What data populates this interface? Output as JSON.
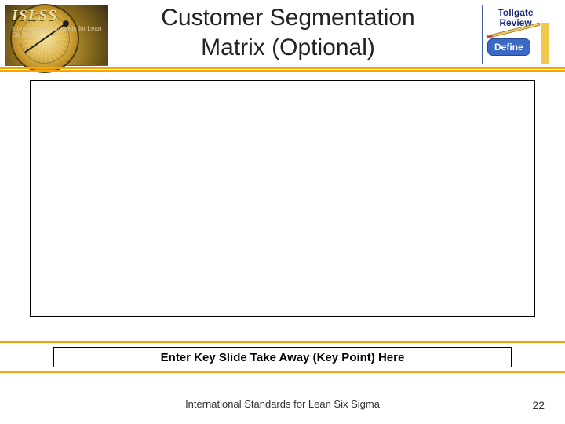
{
  "header": {
    "title_line1": "Customer Segmentation",
    "title_line2": "Matrix (Optional)"
  },
  "logo_left": {
    "brand": "ISLSS",
    "sub": "International Standards for Lean Six Sigma"
  },
  "badge_right": {
    "title_line1": "Tollgate",
    "title_line2": "Review",
    "phase": "Define"
  },
  "takeaway": {
    "text": "Enter Key Slide Take Away (Key Point) Here"
  },
  "footer": {
    "text": "International Standards for Lean Six Sigma",
    "page": "22"
  }
}
